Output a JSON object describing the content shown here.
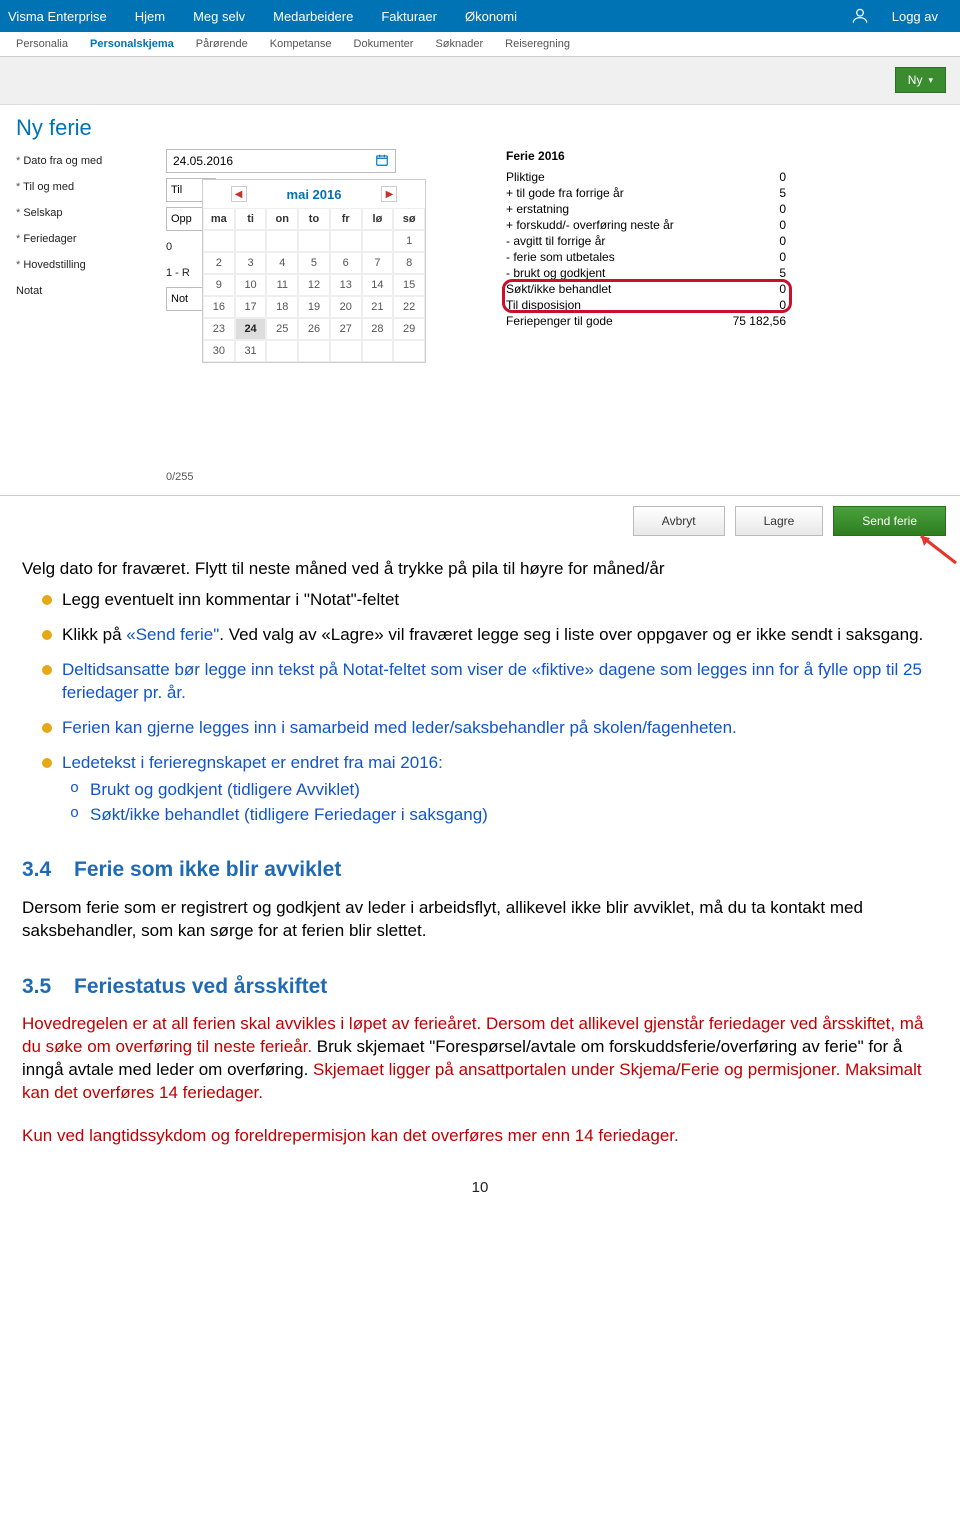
{
  "topnav": {
    "brand": "Visma Enterprise",
    "items": [
      "Hjem",
      "Meg selv",
      "Medarbeidere",
      "Fakturaer",
      "Økonomi"
    ],
    "logout": "Logg av"
  },
  "subnav": {
    "items": [
      "Personalia",
      "Personalskjema",
      "Pårørende",
      "Kompetanse",
      "Dokumenter",
      "Søknader",
      "Reiseregning"
    ],
    "active": "Personalskjema"
  },
  "ny_btn": "Ny",
  "page_title": "Ny ferie",
  "labels": {
    "dato_fra": "Dato fra og med",
    "til_og": "Til og med",
    "selskap": "Selskap",
    "feriedager": "Feriedager",
    "hovedstilling": "Hovedstilling",
    "notat": "Notat"
  },
  "form": {
    "date": "24.05.2016",
    "til_stub": "Til",
    "opp_stub": "Opp",
    "feriedager_val": "0",
    "hoved_val": "1 - R",
    "notat_val": "Not",
    "charcount": "0/255"
  },
  "calendar": {
    "month": "mai 2016",
    "days": [
      "ma",
      "ti",
      "on",
      "to",
      "fr",
      "lø",
      "sø"
    ],
    "weeks": [
      [
        "",
        "",
        "",
        "",
        "",
        "",
        "1"
      ],
      [
        "2",
        "3",
        "4",
        "5",
        "6",
        "7",
        "8"
      ],
      [
        "9",
        "10",
        "11",
        "12",
        "13",
        "14",
        "15"
      ],
      [
        "16",
        "17",
        "18",
        "19",
        "20",
        "21",
        "22"
      ],
      [
        "23",
        "24",
        "25",
        "26",
        "27",
        "28",
        "29"
      ],
      [
        "30",
        "31",
        "",
        "",
        "",
        "",
        ""
      ]
    ],
    "selected": "24"
  },
  "ferie": {
    "title": "Ferie 2016",
    "rows": [
      {
        "label": "Pliktige",
        "val": "0"
      },
      {
        "label": "+ til gode fra forrige år",
        "val": "5"
      },
      {
        "label": "+ erstatning",
        "val": "0"
      },
      {
        "label": "+ forskudd/- overføring neste år",
        "val": "0"
      },
      {
        "label": "- avgitt til forrige år",
        "val": "0"
      },
      {
        "label": "- ferie som utbetales",
        "val": "0"
      },
      {
        "label": "- brukt og godkjent",
        "val": "5"
      },
      {
        "label": "Søkt/ikke behandlet",
        "val": "0"
      },
      {
        "label": "Til disposisjon",
        "val": "0"
      },
      {
        "label": "Feriepenger til gode",
        "val": "75 182,56"
      }
    ]
  },
  "buttons": {
    "avbryt": "Avbryt",
    "lagre": "Lagre",
    "send": "Send ferie"
  },
  "doc": {
    "intro": "Velg dato for fraværet. Flytt til neste måned ved å trykke på pila til høyre for måned/år",
    "b1": "Legg eventuelt inn kommentar i \"Notat\"-feltet",
    "b2a": "Klikk på ",
    "b2b": "«Send ferie\"",
    "b2c": ". Ved valg av «Lagre» vil fraværet legge seg i liste over oppgaver og er ikke sendt i saksgang.",
    "b3": "Deltidsansatte bør legge inn tekst på Notat-feltet som viser de «fiktive» dagene som legges inn for å fylle opp til 25 feriedager pr. år.",
    "b4": "Ferien kan gjerne legges inn i samarbeid med leder/saksbehandler på skolen/fagenheten.",
    "b5": "Ledetekst i ferieregnskapet er endret fra mai 2016:",
    "b5a": "Brukt og godkjent (tidligere Avviklet)",
    "b5b": "Søkt/ikke behandlet (tidligere Feriedager i saksgang)",
    "s34_num": "3.4",
    "s34_title": "Ferie som ikke blir avviklet",
    "s34_body": "Dersom ferie som er registrert og godkjent av leder i arbeidsflyt, allikevel ikke blir avviklet, må du ta kontakt med saksbehandler, som kan sørge for at ferien blir slettet.",
    "s35_num": "3.5",
    "s35_title": "Feriestatus ved årsskiftet",
    "s35_p1": "Hovedregelen er at all ferien skal avvikles i løpet av ferieåret. Dersom det allikevel gjenstår feriedager ved årsskiftet, må du søke om overføring til neste ferieår. ",
    "s35_p2": "Bruk skjemaet \"Forespørsel/avtale om forskuddsferie/overføring av ferie\" for å inngå avtale med leder om overføring. ",
    "s35_p3": "Skjemaet ligger på ansattportalen under Skjema/Ferie og permisjoner. ",
    "s35_p4": "Maksimalt kan det overføres 14 feriedager.",
    "s35_final": "Kun ved langtidssykdom og foreldrepermisjon kan det overføres mer enn 14 feriedager.",
    "page_num": "10"
  }
}
